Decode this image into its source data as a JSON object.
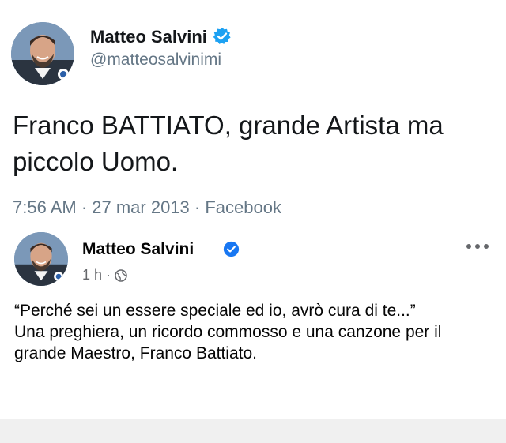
{
  "tweet": {
    "author_name": "Matteo Salvini",
    "handle": "@matteosalvinimi",
    "text": "Franco BATTIATO, grande Artista ma piccolo Uomo.",
    "meta": "7:56 AM · 27 mar 2013 · Facebook"
  },
  "post": {
    "author_name": "Matteo Salvini",
    "time": "1 h",
    "separator": "·",
    "text_line1": "“Perché sei un essere speciale ed io, avrò cura di te...”",
    "text_line2": "Una preghiera, un ricordo commosso e una canzone per il grande Maestro, Franco Battiato."
  },
  "icons": {
    "verified": "verified-badge-icon",
    "globe": "globe-icon",
    "more": "more-options-icon"
  },
  "colors": {
    "twitter_verified": "#1da1f2",
    "facebook_verified": "#1877f2",
    "secondary_text": "#657786"
  }
}
